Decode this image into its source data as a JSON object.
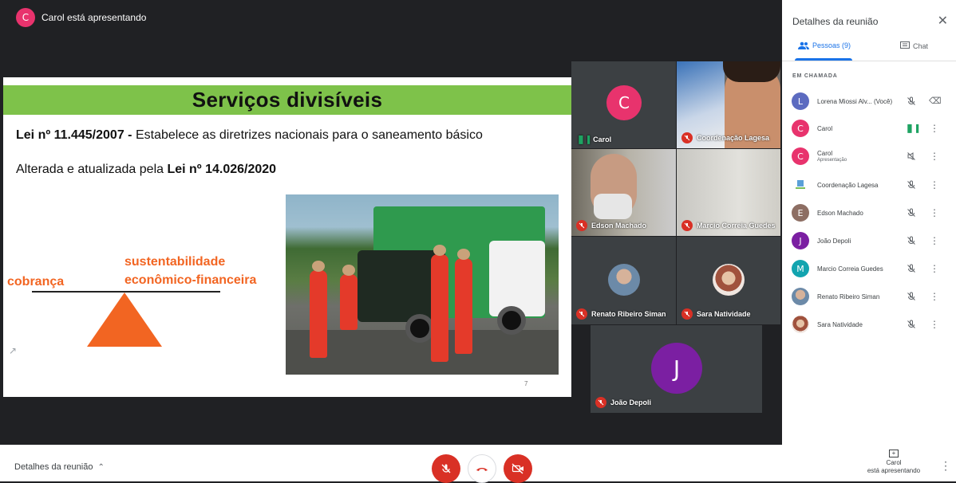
{
  "presenter_banner": {
    "avatar_letter": "C",
    "text": "Carol está apresentando"
  },
  "slide": {
    "title": "Serviços divisíveis",
    "line1_bold": "Lei nº 11.445/2007 -",
    "line1_rest": " Estabelece as diretrizes nacionais para o saneamento básico",
    "line2_rest": "Alterada e atualizada pela ",
    "line2_bold": "Lei nº 14.026/2020",
    "label_sust_1": "sustentabilidade",
    "label_sust_2": "econômico-financeira",
    "label_cobranca": "cobrança",
    "page_mark": "7"
  },
  "tiles": [
    {
      "name": "Carol",
      "avatar": "C"
    },
    {
      "name": "Coordenação Lagesa"
    },
    {
      "name": "Edson Machado"
    },
    {
      "name": "Marcio Correia Guedes"
    },
    {
      "name": "Renato Ribeiro Siman"
    },
    {
      "name": "Sara Natividade"
    },
    {
      "name": "João Depoli",
      "avatar": "J"
    }
  ],
  "panel": {
    "title": "Detalhes da reunião",
    "tab_people": "Pessoas (9)",
    "tab_chat": "Chat",
    "section": "EM CHAMADA",
    "people": [
      {
        "letter": "L",
        "name": "Lorena Miossi Alv...  (Você)",
        "sub": ""
      },
      {
        "letter": "C",
        "name": "Carol",
        "sub": ""
      },
      {
        "letter": "C",
        "name": "Carol",
        "sub": "Apresentação"
      },
      {
        "letter": "",
        "name": "Coordenação Lagesa",
        "sub": ""
      },
      {
        "letter": "E",
        "name": "Edson Machado",
        "sub": ""
      },
      {
        "letter": "J",
        "name": "João Depoli",
        "sub": ""
      },
      {
        "letter": "M",
        "name": "Marcio Correia Guedes",
        "sub": ""
      },
      {
        "letter": "",
        "name": "Renato Ribeiro Siman",
        "sub": ""
      },
      {
        "letter": "",
        "name": "Sara Natividade",
        "sub": ""
      }
    ]
  },
  "bottom": {
    "details": "Detalhes da reunião",
    "presenting_1": "Carol",
    "presenting_2": "está apresentando"
  },
  "colors": {
    "avatar_pink": "#e8336d",
    "avatar_purple": "#7b1fa2",
    "avatar_teal": "#12a4af",
    "avatar_brown": "#8d6e63",
    "avatar_indigo": "#5c6bc0",
    "danger_red": "#d93025",
    "accent_blue": "#1a73e8",
    "slide_green_bar": "#7ec24a",
    "slide_orange": "#f26522"
  }
}
